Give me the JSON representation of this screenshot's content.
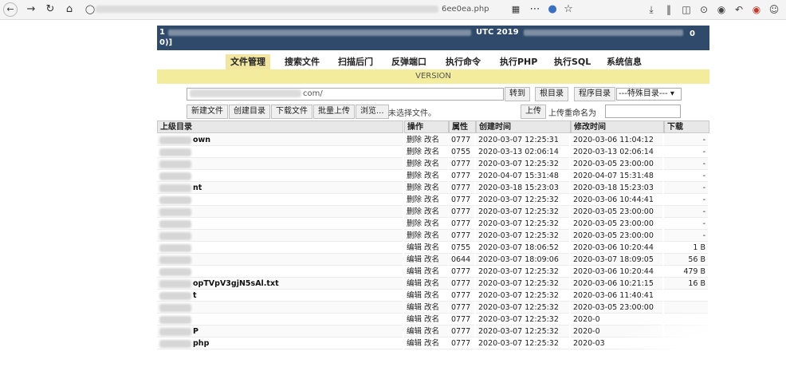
{
  "browser": {
    "url_suffix": "6ee0ea.php",
    "icons": [
      "back-icon",
      "forward-icon",
      "reload-icon",
      "home-icon",
      "shield-icon",
      "lock-icon",
      "qr-icon",
      "more-icon",
      "pocket-icon",
      "star-icon",
      "download-icon",
      "library-icon",
      "sidebar-icon",
      "screenshot-icon",
      "chat-icon",
      "undo-icon",
      "addon-icon",
      "account-icon"
    ]
  },
  "banner": {
    "line1_prefix": "1",
    "line1_mid": "UTC 2019",
    "line1_right": "0",
    "line2": "0)]"
  },
  "tabs": [
    {
      "label": "文件管理",
      "active": true
    },
    {
      "label": "搜索文件",
      "active": false
    },
    {
      "label": "扫描后门",
      "active": false
    },
    {
      "label": "反弹端口",
      "active": false
    },
    {
      "label": "执行命令",
      "active": false
    },
    {
      "label": "执行PHP",
      "active": false
    },
    {
      "label": "执行SQL",
      "active": false
    },
    {
      "label": "系统信息",
      "active": false
    }
  ],
  "version_text": "VERSION",
  "path_bar": {
    "path_value_suffix": "com/",
    "go_button": "转到",
    "root_button": "根目录",
    "prog_button": "程序目录",
    "special_dir": "---特殊目录---"
  },
  "actions": {
    "new_file": "新建文件",
    "create_dir": "创建目录",
    "download_file": "下载文件",
    "batch_upload": "批量上传",
    "browse": "浏览...",
    "no_file_selected": "未选择文件。",
    "upload": "上传",
    "upload_rename_label": "上传重命名为"
  },
  "table": {
    "headers": {
      "name": "上级目录",
      "ops": "操作",
      "perm": "属性",
      "ctime": "创建时间",
      "mtime": "修改时间",
      "size": "下载"
    },
    "rows": [
      {
        "name": "own",
        "op1": "删除",
        "op2": "改名",
        "perm": "0777",
        "ctime": "2020-03-07 12:25:31",
        "mtime": "2020-03-06 11:04:12",
        "size": "-"
      },
      {
        "name": "",
        "op1": "删除",
        "op2": "改名",
        "perm": "0755",
        "ctime": "2020-03-13 02:06:14",
        "mtime": "2020-03-13 02:06:14",
        "size": "-"
      },
      {
        "name": "",
        "op1": "删除",
        "op2": "改名",
        "perm": "0777",
        "ctime": "2020-03-07 12:25:32",
        "mtime": "2020-03-05 23:00:00",
        "size": "-"
      },
      {
        "name": "",
        "op1": "删除",
        "op2": "改名",
        "perm": "0777",
        "ctime": "2020-04-07 15:31:48",
        "mtime": "2020-04-07 15:31:48",
        "size": "-"
      },
      {
        "name": "nt",
        "op1": "删除",
        "op2": "改名",
        "perm": "0777",
        "ctime": "2020-03-18 15:23:03",
        "mtime": "2020-03-18 15:23:03",
        "size": "-"
      },
      {
        "name": "",
        "op1": "删除",
        "op2": "改名",
        "perm": "0777",
        "ctime": "2020-03-07 12:25:32",
        "mtime": "2020-03-06 10:44:41",
        "size": "-"
      },
      {
        "name": "",
        "op1": "删除",
        "op2": "改名",
        "perm": "0777",
        "ctime": "2020-03-07 12:25:32",
        "mtime": "2020-03-05 23:00:00",
        "size": "-"
      },
      {
        "name": "",
        "op1": "删除",
        "op2": "改名",
        "perm": "0777",
        "ctime": "2020-03-07 12:25:32",
        "mtime": "2020-03-05 23:00:00",
        "size": "-"
      },
      {
        "name": "",
        "op1": "删除",
        "op2": "改名",
        "perm": "0777",
        "ctime": "2020-03-07 12:25:32",
        "mtime": "2020-03-05 23:00:00",
        "size": "-"
      },
      {
        "name": "",
        "op1": "编辑",
        "op2": "改名",
        "perm": "0755",
        "ctime": "2020-03-07 18:06:52",
        "mtime": "2020-03-06 10:20:44",
        "size": "1 B"
      },
      {
        "name": "",
        "op1": "编辑",
        "op2": "改名",
        "perm": "0644",
        "ctime": "2020-03-07 18:09:06",
        "mtime": "2020-03-07 18:09:05",
        "size": "56 B"
      },
      {
        "name": "",
        "op1": "编辑",
        "op2": "改名",
        "perm": "0777",
        "ctime": "2020-03-07 12:25:32",
        "mtime": "2020-03-06 10:20:44",
        "size": "479 B"
      },
      {
        "name": "opTVpV3gjN5sAl.txt",
        "op1": "编辑",
        "op2": "改名",
        "perm": "0777",
        "ctime": "2020-03-07 12:25:32",
        "mtime": "2020-03-06 10:21:15",
        "size": "16 B"
      },
      {
        "name": "t",
        "op1": "编辑",
        "op2": "改名",
        "perm": "0777",
        "ctime": "2020-03-07 12:25:32",
        "mtime": "2020-03-06 11:40:41",
        "size": ""
      },
      {
        "name": "",
        "op1": "编辑",
        "op2": "改名",
        "perm": "0777",
        "ctime": "2020-03-07 12:25:32",
        "mtime": "2020-03-05 23:00:00",
        "size": ""
      },
      {
        "name": "",
        "op1": "编辑",
        "op2": "改名",
        "perm": "0777",
        "ctime": "2020-03-07 12:25:32",
        "mtime": "2020-0",
        "size": ""
      },
      {
        "name": "P",
        "op1": "编辑",
        "op2": "改名",
        "perm": "0777",
        "ctime": "2020-03-07 12:25:32",
        "mtime": "2020-0",
        "size": ""
      },
      {
        "name": "php",
        "op1": "编辑",
        "op2": "改名",
        "perm": "0777",
        "ctime": "2020-03-07 12:25:32",
        "mtime": "2020-03",
        "size": ""
      }
    ]
  }
}
